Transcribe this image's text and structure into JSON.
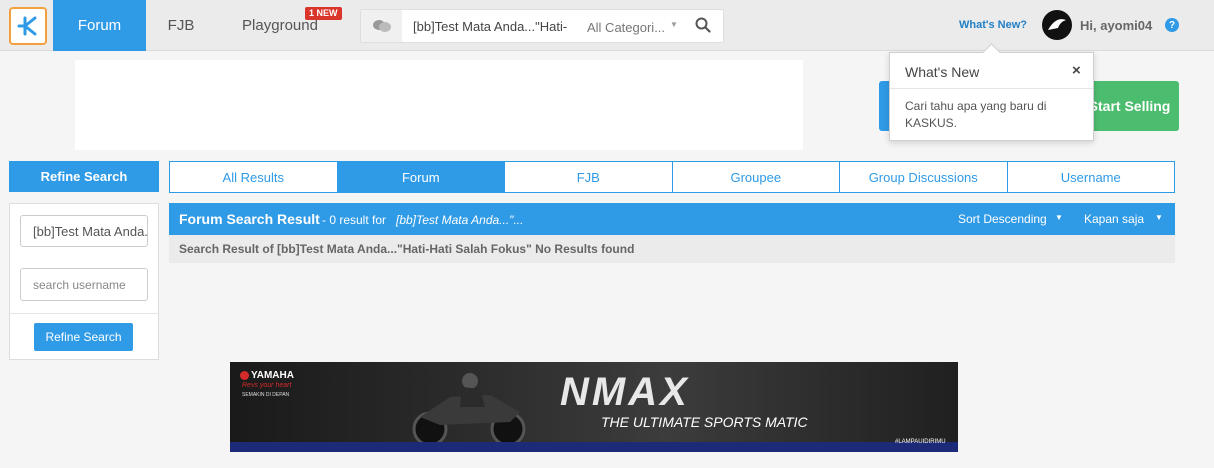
{
  "nav": {
    "logo_icon": "kaskus-logo-icon",
    "forum": "Forum",
    "fjb": "FJB",
    "playground": "Playground",
    "playground_badge": "1 NEW"
  },
  "search": {
    "chat_icon": "chat-bubbles-icon",
    "query": "[bb]Test Mata Anda...\"Hati-",
    "category": "All Categori...",
    "search_icon": "search-icon"
  },
  "user": {
    "whats_new_link": "What's New?",
    "greeting": "Hi, ayomi04",
    "help": "?"
  },
  "popover": {
    "title": "What's New",
    "close": "×",
    "body": "Cari tahu apa yang baru di KASKUS."
  },
  "start_selling": "Start Selling",
  "sidebar": {
    "header": "Refine Search",
    "query_value": "[bb]Test Mata Anda...\"Hati-Hati Salah Fokus\"",
    "username_placeholder": "search username",
    "button": "Refine Search"
  },
  "tabs": [
    "All Results",
    "Forum",
    "FJB",
    "Groupee",
    "Group Discussions",
    "Username"
  ],
  "active_tab": "Forum",
  "results": {
    "title": "Forum Search Result",
    "meta": "- 0 result for",
    "query": "[bb]Test Mata Anda...\"...",
    "sort": "Sort Descending",
    "time": "Kapan saja",
    "no_results": "Search Result of [bb]Test Mata Anda...\"Hati-Hati Salah Fokus\" No Results found"
  },
  "banner": {
    "brand": "YAMAHA",
    "tagline_small": "Revs your heart",
    "tagline_tiny": "SEMAKIN DI DEPAN",
    "logo": "NMAX",
    "tagline": "THE ULTIMATE SPORTS MATIC",
    "hashtag": "#LAMPAUIDIRIMU"
  },
  "colors": {
    "accent": "#2f9ae6",
    "start_selling": "#4cbc6e",
    "badge": "#d9352b"
  }
}
